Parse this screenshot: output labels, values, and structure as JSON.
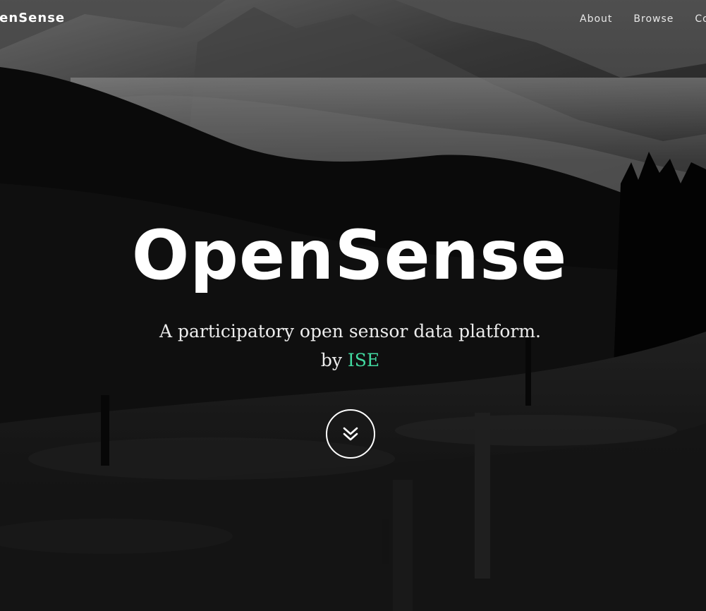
{
  "navbar": {
    "brand": "OpenSense",
    "links": [
      "About",
      "Browse",
      "Contact"
    ]
  },
  "hero": {
    "title": "OpenSense",
    "subtitle": "A participatory open sensor data platform.",
    "byline_prefix": "by",
    "byline_link": "ISE",
    "scroll_icon": "double-chevron-down-icon"
  },
  "colors": {
    "accent": "#42d9a0",
    "text": "#ffffff"
  }
}
